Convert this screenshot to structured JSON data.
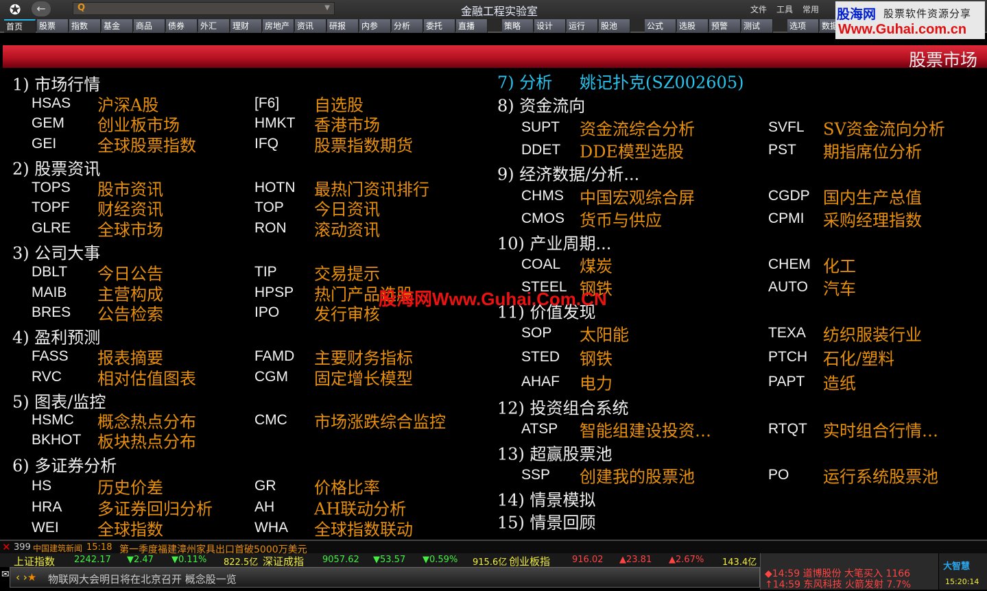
{
  "app": {
    "title": "金融工程实验室",
    "menus": [
      "文件",
      "工具",
      "常用"
    ]
  },
  "nav": {
    "tabs": [
      "首页",
      "股票",
      "指数",
      "基金",
      "商品",
      "债券",
      "外汇",
      "理财",
      "房地产",
      "资讯",
      "研报",
      "内参",
      "分析",
      "委托",
      "直播",
      "策略",
      "设计",
      "运行",
      "股池",
      "公式",
      "选股",
      "预警",
      "测试",
      "选项",
      "数据"
    ]
  },
  "watermark": {
    "logo": "股海网",
    "tagline": "股票软件资源分享",
    "url": "Www.Guhai.com.cn",
    "overlay": "股海网Www.Guhai.Com.CN"
  },
  "banner": {
    "title": "股票市场"
  },
  "left_rows": [
    {
      "h": "1) 市场行情"
    },
    {
      "c1": "HSAS",
      "n1": "沪深A股",
      "c2": "[F6]",
      "n2": "自选股"
    },
    {
      "c1": "GEM",
      "n1": "创业板市场",
      "c2": "HMKT",
      "n2": "香港市场"
    },
    {
      "c1": "GEI",
      "n1": "全球股票指数",
      "c2": "IFQ",
      "n2": "股票指数期货"
    },
    {
      "h": "2) 股票资讯"
    },
    {
      "c1": "TOPS",
      "n1": "股市资讯",
      "c2": "HOTN",
      "n2": "最热门资讯排行"
    },
    {
      "c1": "TOPF",
      "n1": "财经资讯",
      "c2": "TOP",
      "n2": "今日资讯"
    },
    {
      "c1": "GLRE",
      "n1": "全球市场",
      "c2": "RON",
      "n2": "滚动资讯"
    },
    {
      "h": "3) 公司大事"
    },
    {
      "c1": "DBLT",
      "n1": "今日公告",
      "c2": "TIP",
      "n2": "交易提示"
    },
    {
      "c1": "MAIB",
      "n1": "主营构成",
      "c2": "HPSP",
      "n2": "热门产品选股"
    },
    {
      "c1": "BRES",
      "n1": "公告检索",
      "c2": "IPO",
      "n2": "发行审核"
    },
    {
      "h": "4) 盈利预测"
    },
    {
      "c1": "FASS",
      "n1": "报表摘要",
      "c2": "FAMD",
      "n2": "主要财务指标"
    },
    {
      "c1": "RVC",
      "n1": "相对估值图表",
      "c2": "CGM",
      "n2": "固定增长模型"
    },
    {
      "h": "5) 图表/监控"
    },
    {
      "c1": "HSMC",
      "n1": "概念热点分布",
      "c2": "CMC",
      "n2": "市场涨跌综合监控"
    },
    {
      "c1": "BKHOT",
      "n1": "板块热点分布"
    },
    {
      "h": "6) 多证券分析"
    },
    {
      "c1": "HS",
      "n1": "历史价差",
      "c2": "GR",
      "n2": "价格比率"
    },
    {
      "c1": "HRA",
      "n1": "多证券回归分析",
      "c2": "AH",
      "n2": "AH联动分析"
    },
    {
      "c1": "WEI",
      "n1": "全球指数",
      "c2": "WHA",
      "n2": "全球指数联动"
    }
  ],
  "right_rows": [
    {
      "h": "7) 分析",
      "link": "姚记扑克(SZ002605)"
    },
    {
      "h": "8) 资金流向"
    },
    {
      "c1": "SUPT",
      "n1": "资金流综合分析",
      "c2": "SVFL",
      "n2": "SV资金流向分析"
    },
    {
      "c1": "DDET",
      "n1": "DDE模型选股",
      "c2": "PST",
      "n2": "期指席位分析"
    },
    {
      "h": "9) 经济数据/分析..."
    },
    {
      "c1": "CHMS",
      "n1": "中国宏观综合屏",
      "c2": "CGDP",
      "n2": "国内生产总值"
    },
    {
      "c1": "CMOS",
      "n1": "货币与供应",
      "c2": "CPMI",
      "n2": "采购经理指数"
    },
    {
      "h": "10) 产业周期..."
    },
    {
      "c1": "COAL",
      "n1": "煤炭",
      "c2": "CHEM",
      "n2": "化工"
    },
    {
      "c1": "STEEL",
      "n1": "钢铁",
      "c2": "AUTO",
      "n2": "汽车"
    },
    {
      "h": "11) 价值发现"
    },
    {
      "c1": "SOP",
      "n1": "太阳能",
      "c2": "TEXA",
      "n2": "纺织服装行业"
    },
    {
      "c1": "STED",
      "n1": "钢铁",
      "c2": "PTCH",
      "n2": "石化/塑料"
    },
    {
      "c1": "AHAF",
      "n1": "电力",
      "c2": "PAPT",
      "n2": "造纸"
    },
    {
      "h": "12) 投资组合系统"
    },
    {
      "c1": "ATSP",
      "n1": "智能组建设投资…",
      "c2": "RTQT",
      "n2": "实时组合行情…"
    },
    {
      "h": "13) 超赢股票池"
    },
    {
      "c1": "SSP",
      "n1": "创建我的股票池",
      "c2": "PO",
      "n2": "运行系统股票池"
    },
    {
      "h": "14) 情景模拟"
    },
    {
      "h": "15) 情景回顾"
    }
  ],
  "news": {
    "count": "399",
    "source": "中国建筑新闻",
    "time": "15:18",
    "headline": "第一季度福建漳州家具出口首破5000万美元"
  },
  "ticker": [
    {
      "t": "上证指数",
      "c": "#f4f040"
    },
    {
      "t": "2242.17",
      "c": "#44ee44"
    },
    {
      "t": "▼2.47",
      "c": "#44ee44"
    },
    {
      "t": "▼0.11%",
      "c": "#44ee44"
    },
    {
      "t": "822.5亿",
      "c": "#f4f040"
    },
    {
      "t": "深证成指",
      "c": "#f4f040"
    },
    {
      "t": "9057.62",
      "c": "#44ee44"
    },
    {
      "t": "▼53.57",
      "c": "#44ee44"
    },
    {
      "t": "▼0.59%",
      "c": "#44ee44"
    },
    {
      "t": "915.6亿",
      "c": "#f4f040"
    },
    {
      "t": "创业板指",
      "c": "#f4f040"
    },
    {
      "t": "916.02",
      "c": "#ff4444"
    },
    {
      "t": "▲23.81",
      "c": "#ff4444"
    },
    {
      "t": "▲2.67%",
      "c": "#ff4444"
    },
    {
      "t": "143.4亿",
      "c": "#f4f040"
    }
  ],
  "message": {
    "text": "物联网大会明日将在北京召开 概念股一览"
  },
  "alerts": [
    "◆14:59 道博股份 大笔买入 1166",
    "↑14:59 东风科技 火箭发射 7.7%"
  ],
  "brand": {
    "name": "大智慧",
    "clock": "15:20:14"
  },
  "colors": {
    "heading": "#f0f0f0",
    "code": "#f4f4f4",
    "name": "#e8900a",
    "link": "#27c4ee",
    "banner": "#c01828"
  }
}
